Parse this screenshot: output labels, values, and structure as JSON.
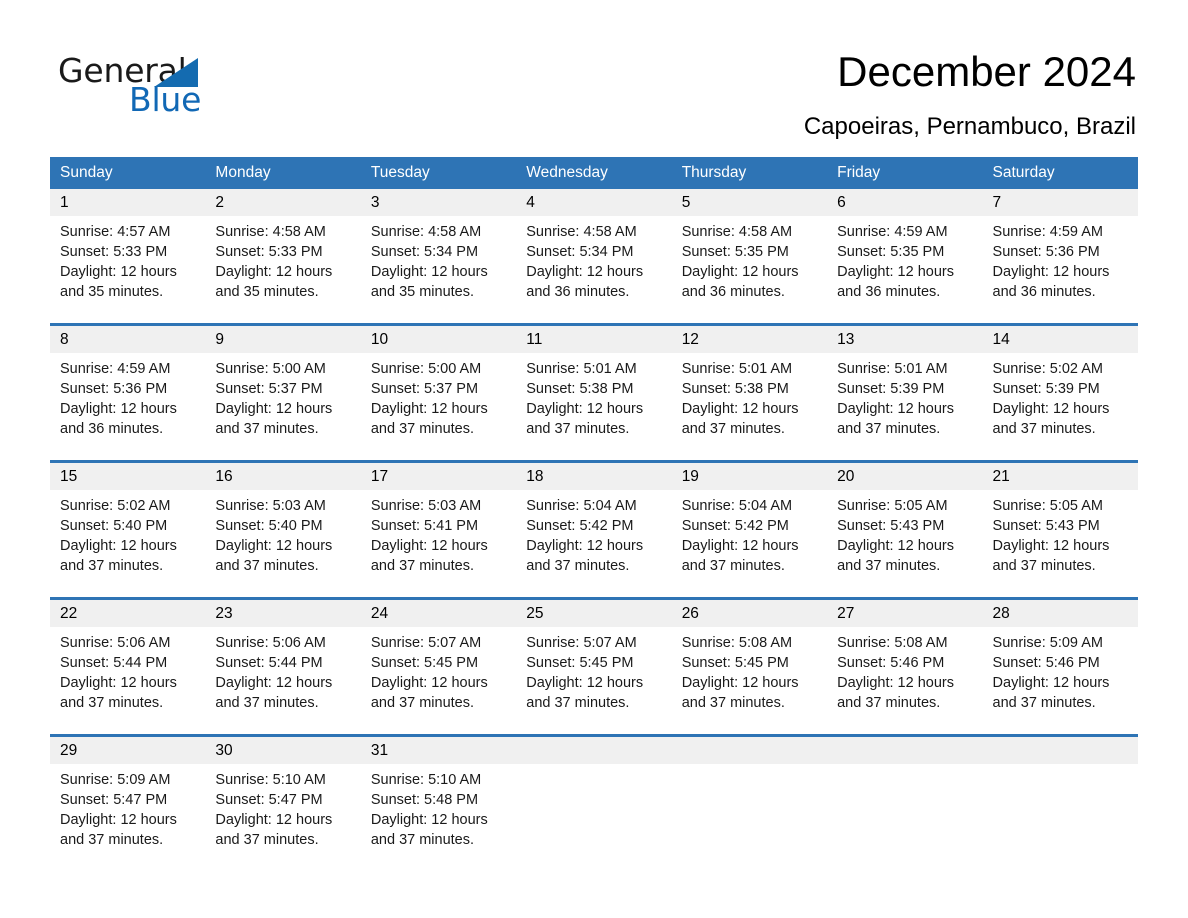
{
  "brand": {
    "name_part1": "General",
    "name_part2": "Blue",
    "triangle_color": "#146BB0",
    "blue_text_color": "#1168B5"
  },
  "header": {
    "title": "December 2024",
    "subtitle": "Capoeiras, Pernambuco, Brazil"
  },
  "theme": {
    "header_blue": "#2E74B5",
    "day_band_gray": "#F0F0F0",
    "text_black": "#000000"
  },
  "calendar": {
    "weekday_headers": [
      "Sunday",
      "Monday",
      "Tuesday",
      "Wednesday",
      "Thursday",
      "Friday",
      "Saturday"
    ],
    "weeks": [
      {
        "days": [
          {
            "num": "1",
            "l1": "Sunrise: 4:57 AM",
            "l2": "Sunset: 5:33 PM",
            "l3": "Daylight: 12 hours",
            "l4": "and 35 minutes."
          },
          {
            "num": "2",
            "l1": "Sunrise: 4:58 AM",
            "l2": "Sunset: 5:33 PM",
            "l3": "Daylight: 12 hours",
            "l4": "and 35 minutes."
          },
          {
            "num": "3",
            "l1": "Sunrise: 4:58 AM",
            "l2": "Sunset: 5:34 PM",
            "l3": "Daylight: 12 hours",
            "l4": "and 35 minutes."
          },
          {
            "num": "4",
            "l1": "Sunrise: 4:58 AM",
            "l2": "Sunset: 5:34 PM",
            "l3": "Daylight: 12 hours",
            "l4": "and 36 minutes."
          },
          {
            "num": "5",
            "l1": "Sunrise: 4:58 AM",
            "l2": "Sunset: 5:35 PM",
            "l3": "Daylight: 12 hours",
            "l4": "and 36 minutes."
          },
          {
            "num": "6",
            "l1": "Sunrise: 4:59 AM",
            "l2": "Sunset: 5:35 PM",
            "l3": "Daylight: 12 hours",
            "l4": "and 36 minutes."
          },
          {
            "num": "7",
            "l1": "Sunrise: 4:59 AM",
            "l2": "Sunset: 5:36 PM",
            "l3": "Daylight: 12 hours",
            "l4": "and 36 minutes."
          }
        ]
      },
      {
        "days": [
          {
            "num": "8",
            "l1": "Sunrise: 4:59 AM",
            "l2": "Sunset: 5:36 PM",
            "l3": "Daylight: 12 hours",
            "l4": "and 36 minutes."
          },
          {
            "num": "9",
            "l1": "Sunrise: 5:00 AM",
            "l2": "Sunset: 5:37 PM",
            "l3": "Daylight: 12 hours",
            "l4": "and 37 minutes."
          },
          {
            "num": "10",
            "l1": "Sunrise: 5:00 AM",
            "l2": "Sunset: 5:37 PM",
            "l3": "Daylight: 12 hours",
            "l4": "and 37 minutes."
          },
          {
            "num": "11",
            "l1": "Sunrise: 5:01 AM",
            "l2": "Sunset: 5:38 PM",
            "l3": "Daylight: 12 hours",
            "l4": "and 37 minutes."
          },
          {
            "num": "12",
            "l1": "Sunrise: 5:01 AM",
            "l2": "Sunset: 5:38 PM",
            "l3": "Daylight: 12 hours",
            "l4": "and 37 minutes."
          },
          {
            "num": "13",
            "l1": "Sunrise: 5:01 AM",
            "l2": "Sunset: 5:39 PM",
            "l3": "Daylight: 12 hours",
            "l4": "and 37 minutes."
          },
          {
            "num": "14",
            "l1": "Sunrise: 5:02 AM",
            "l2": "Sunset: 5:39 PM",
            "l3": "Daylight: 12 hours",
            "l4": "and 37 minutes."
          }
        ]
      },
      {
        "days": [
          {
            "num": "15",
            "l1": "Sunrise: 5:02 AM",
            "l2": "Sunset: 5:40 PM",
            "l3": "Daylight: 12 hours",
            "l4": "and 37 minutes."
          },
          {
            "num": "16",
            "l1": "Sunrise: 5:03 AM",
            "l2": "Sunset: 5:40 PM",
            "l3": "Daylight: 12 hours",
            "l4": "and 37 minutes."
          },
          {
            "num": "17",
            "l1": "Sunrise: 5:03 AM",
            "l2": "Sunset: 5:41 PM",
            "l3": "Daylight: 12 hours",
            "l4": "and 37 minutes."
          },
          {
            "num": "18",
            "l1": "Sunrise: 5:04 AM",
            "l2": "Sunset: 5:42 PM",
            "l3": "Daylight: 12 hours",
            "l4": "and 37 minutes."
          },
          {
            "num": "19",
            "l1": "Sunrise: 5:04 AM",
            "l2": "Sunset: 5:42 PM",
            "l3": "Daylight: 12 hours",
            "l4": "and 37 minutes."
          },
          {
            "num": "20",
            "l1": "Sunrise: 5:05 AM",
            "l2": "Sunset: 5:43 PM",
            "l3": "Daylight: 12 hours",
            "l4": "and 37 minutes."
          },
          {
            "num": "21",
            "l1": "Sunrise: 5:05 AM",
            "l2": "Sunset: 5:43 PM",
            "l3": "Daylight: 12 hours",
            "l4": "and 37 minutes."
          }
        ]
      },
      {
        "days": [
          {
            "num": "22",
            "l1": "Sunrise: 5:06 AM",
            "l2": "Sunset: 5:44 PM",
            "l3": "Daylight: 12 hours",
            "l4": "and 37 minutes."
          },
          {
            "num": "23",
            "l1": "Sunrise: 5:06 AM",
            "l2": "Sunset: 5:44 PM",
            "l3": "Daylight: 12 hours",
            "l4": "and 37 minutes."
          },
          {
            "num": "24",
            "l1": "Sunrise: 5:07 AM",
            "l2": "Sunset: 5:45 PM",
            "l3": "Daylight: 12 hours",
            "l4": "and 37 minutes."
          },
          {
            "num": "25",
            "l1": "Sunrise: 5:07 AM",
            "l2": "Sunset: 5:45 PM",
            "l3": "Daylight: 12 hours",
            "l4": "and 37 minutes."
          },
          {
            "num": "26",
            "l1": "Sunrise: 5:08 AM",
            "l2": "Sunset: 5:45 PM",
            "l3": "Daylight: 12 hours",
            "l4": "and 37 minutes."
          },
          {
            "num": "27",
            "l1": "Sunrise: 5:08 AM",
            "l2": "Sunset: 5:46 PM",
            "l3": "Daylight: 12 hours",
            "l4": "and 37 minutes."
          },
          {
            "num": "28",
            "l1": "Sunrise: 5:09 AM",
            "l2": "Sunset: 5:46 PM",
            "l3": "Daylight: 12 hours",
            "l4": "and 37 minutes."
          }
        ]
      },
      {
        "days": [
          {
            "num": "29",
            "l1": "Sunrise: 5:09 AM",
            "l2": "Sunset: 5:47 PM",
            "l3": "Daylight: 12 hours",
            "l4": "and 37 minutes."
          },
          {
            "num": "30",
            "l1": "Sunrise: 5:10 AM",
            "l2": "Sunset: 5:47 PM",
            "l3": "Daylight: 12 hours",
            "l4": "and 37 minutes."
          },
          {
            "num": "31",
            "l1": "Sunrise: 5:10 AM",
            "l2": "Sunset: 5:48 PM",
            "l3": "Daylight: 12 hours",
            "l4": "and 37 minutes."
          },
          {
            "num": "",
            "l1": "",
            "l2": "",
            "l3": "",
            "l4": ""
          },
          {
            "num": "",
            "l1": "",
            "l2": "",
            "l3": "",
            "l4": ""
          },
          {
            "num": "",
            "l1": "",
            "l2": "",
            "l3": "",
            "l4": ""
          },
          {
            "num": "",
            "l1": "",
            "l2": "",
            "l3": "",
            "l4": ""
          }
        ]
      }
    ]
  }
}
